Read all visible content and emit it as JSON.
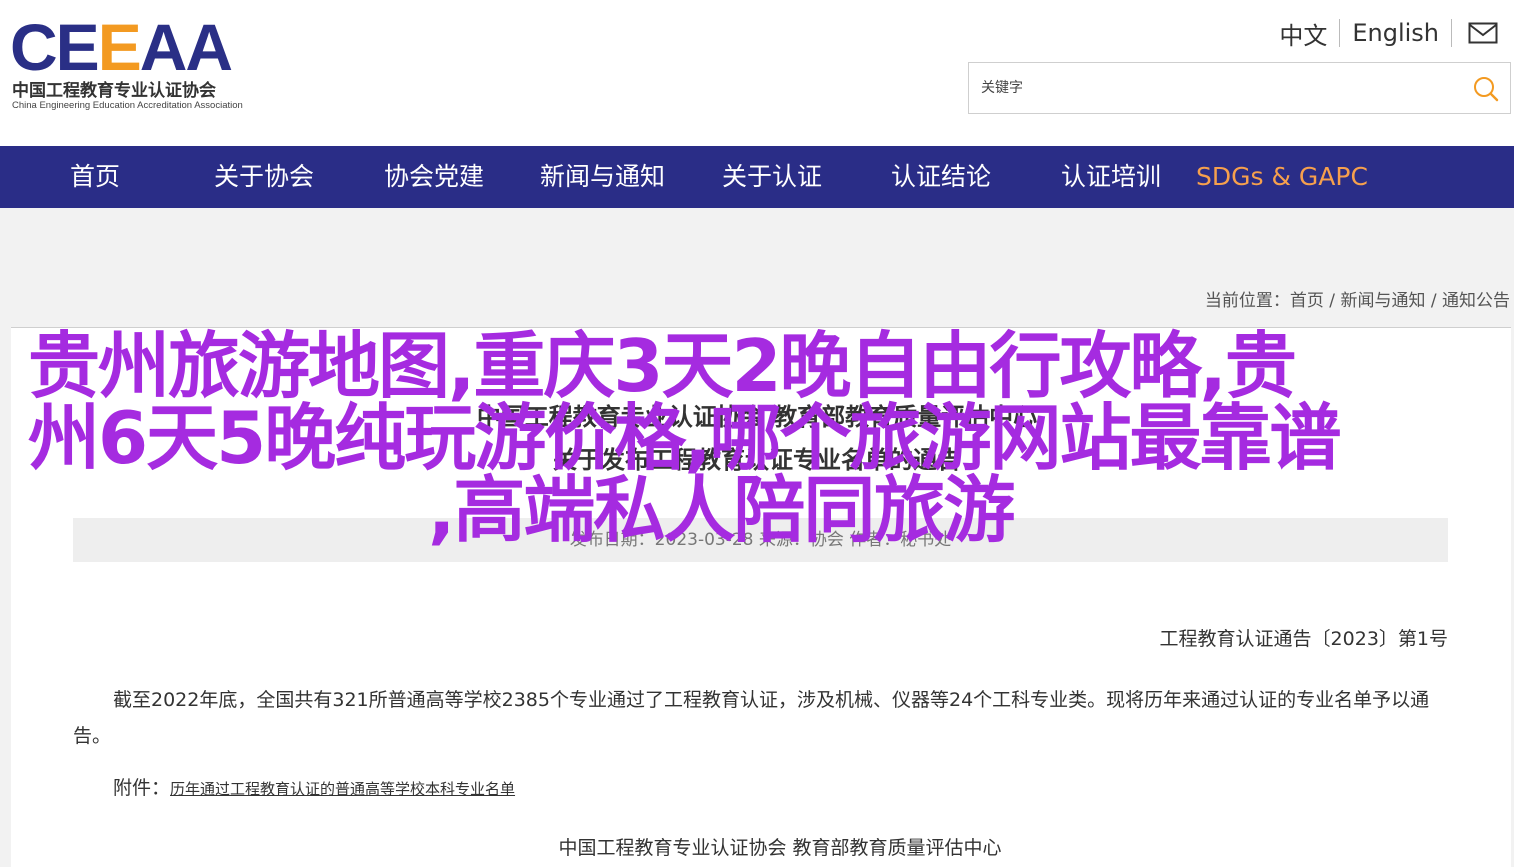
{
  "header": {
    "logo": {
      "mark_left": "CE",
      "mark_mid": "E",
      "mark_right": "AA",
      "cn_name": "中国工程教育专业认证协会",
      "en_name": "China Engineering Education Accreditation Association"
    },
    "lang": {
      "zh": "中文",
      "en": "English"
    },
    "search": {
      "placeholder": "关键字"
    }
  },
  "nav": {
    "items": [
      {
        "label": "首页"
      },
      {
        "label": "关于协会"
      },
      {
        "label": "协会党建"
      },
      {
        "label": "新闻与通知"
      },
      {
        "label": "关于认证"
      },
      {
        "label": "认证结论"
      },
      {
        "label": "认证培训"
      },
      {
        "label": "SDGs & GAPC"
      }
    ],
    "accent_color": "#f6a04d",
    "bg_color": "#2a2d87"
  },
  "breadcrumb": {
    "prefix": "当前位置：",
    "items": [
      "首页",
      "新闻与通知",
      "通知公告"
    ],
    "sep": " / "
  },
  "article": {
    "title_line1": "中国工程教育专业认证协会 教育部教育质量评估中心",
    "title_line2": "关于发布工程教育认证专业名单的通告",
    "meta": "发布日期：2023-03-28   来源：协会   作者：秘书处",
    "announce_no": "工程教育认证通告〔2023〕第1号",
    "paragraph": "截至2022年底，全国共有321所普通高等学校2385个专业通过了工程教育认证，涉及机械、仪器等24个工科专业类。现将历年来通过认证的专业名单予以通告。",
    "attach_label": "附件：",
    "attach_link": "历年通过工程教育认证的普通高等学校本科专业名单",
    "signature": "中国工程教育专业认证协会     教育部教育质量评估中心"
  },
  "overlay": {
    "line1": "贵州旅游地图,重庆3天2晚自由行攻略,贵",
    "line2": "州6天5晚纯玩游价格,哪个旅游网站最靠谱",
    "line3": ",高端私人陪同旅游",
    "color": "#a52be0"
  }
}
